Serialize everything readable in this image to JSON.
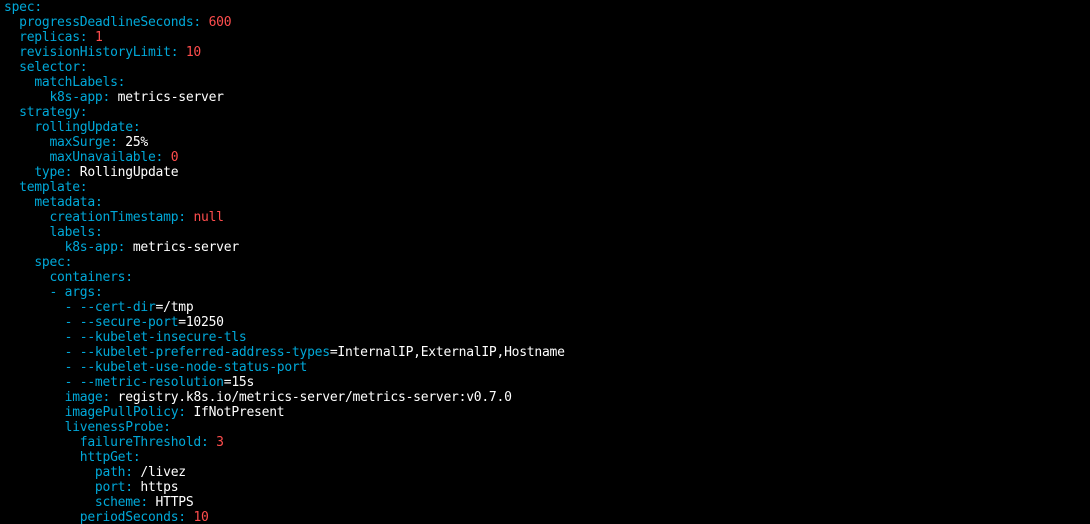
{
  "colors": {
    "background": "#000000",
    "key": "#00a8d8",
    "string_value": "#ffffff",
    "number_value": "#ff4d4d"
  },
  "lines": [
    {
      "indent": "",
      "key": "spec",
      "sep": ":",
      "value": "",
      "vtype": "v"
    },
    {
      "indent": "  ",
      "key": "progressDeadlineSeconds",
      "sep": ": ",
      "value": "600",
      "vtype": "n"
    },
    {
      "indent": "  ",
      "key": "replicas",
      "sep": ": ",
      "value": "1",
      "vtype": "n"
    },
    {
      "indent": "  ",
      "key": "revisionHistoryLimit",
      "sep": ": ",
      "value": "10",
      "vtype": "n"
    },
    {
      "indent": "  ",
      "key": "selector",
      "sep": ":",
      "value": "",
      "vtype": "v"
    },
    {
      "indent": "    ",
      "key": "matchLabels",
      "sep": ":",
      "value": "",
      "vtype": "v"
    },
    {
      "indent": "      ",
      "key": "k8s-app",
      "sep": ": ",
      "value": "metrics-server",
      "vtype": "v"
    },
    {
      "indent": "  ",
      "key": "strategy",
      "sep": ":",
      "value": "",
      "vtype": "v"
    },
    {
      "indent": "    ",
      "key": "rollingUpdate",
      "sep": ":",
      "value": "",
      "vtype": "v"
    },
    {
      "indent": "      ",
      "key": "maxSurge",
      "sep": ": ",
      "value": "25%",
      "vtype": "v"
    },
    {
      "indent": "      ",
      "key": "maxUnavailable",
      "sep": ": ",
      "value": "0",
      "vtype": "n"
    },
    {
      "indent": "    ",
      "key": "type",
      "sep": ": ",
      "value": "RollingUpdate",
      "vtype": "v"
    },
    {
      "indent": "  ",
      "key": "template",
      "sep": ":",
      "value": "",
      "vtype": "v"
    },
    {
      "indent": "    ",
      "key": "metadata",
      "sep": ":",
      "value": "",
      "vtype": "v"
    },
    {
      "indent": "      ",
      "key": "creationTimestamp",
      "sep": ": ",
      "value": "null",
      "vtype": "n"
    },
    {
      "indent": "      ",
      "key": "labels",
      "sep": ":",
      "value": "",
      "vtype": "v"
    },
    {
      "indent": "        ",
      "key": "k8s-app",
      "sep": ": ",
      "value": "metrics-server",
      "vtype": "v"
    },
    {
      "indent": "    ",
      "key": "spec",
      "sep": ":",
      "value": "",
      "vtype": "v"
    },
    {
      "indent": "      ",
      "key": "containers",
      "sep": ":",
      "value": "",
      "vtype": "v"
    },
    {
      "indent": "      ",
      "key": "- args",
      "sep": ":",
      "value": "",
      "vtype": "v"
    },
    {
      "indent": "        ",
      "key": "- --cert-dir",
      "sep": "",
      "value": "=/tmp",
      "vtype": "v"
    },
    {
      "indent": "        ",
      "key": "- --secure-port",
      "sep": "",
      "value": "=10250",
      "vtype": "v"
    },
    {
      "indent": "        ",
      "key": "- --kubelet-insecure-tls",
      "sep": "",
      "value": "",
      "vtype": "v"
    },
    {
      "indent": "        ",
      "key": "- --kubelet-preferred-address-types",
      "sep": "",
      "value": "=InternalIP,ExternalIP,Hostname",
      "vtype": "v"
    },
    {
      "indent": "        ",
      "key": "- --kubelet-use-node-status-port",
      "sep": "",
      "value": "",
      "vtype": "v"
    },
    {
      "indent": "        ",
      "key": "- --metric-resolution",
      "sep": "",
      "value": "=15s",
      "vtype": "v"
    },
    {
      "indent": "        ",
      "key": "image",
      "sep": ": ",
      "value": "registry.k8s.io/metrics-server/metrics-server:v0.7.0",
      "vtype": "v"
    },
    {
      "indent": "        ",
      "key": "imagePullPolicy",
      "sep": ": ",
      "value": "IfNotPresent",
      "vtype": "v"
    },
    {
      "indent": "        ",
      "key": "livenessProbe",
      "sep": ":",
      "value": "",
      "vtype": "v"
    },
    {
      "indent": "          ",
      "key": "failureThreshold",
      "sep": ": ",
      "value": "3",
      "vtype": "n"
    },
    {
      "indent": "          ",
      "key": "httpGet",
      "sep": ":",
      "value": "",
      "vtype": "v"
    },
    {
      "indent": "            ",
      "key": "path",
      "sep": ": ",
      "value": "/livez",
      "vtype": "v"
    },
    {
      "indent": "            ",
      "key": "port",
      "sep": ": ",
      "value": "https",
      "vtype": "v"
    },
    {
      "indent": "            ",
      "key": "scheme",
      "sep": ": ",
      "value": "HTTPS",
      "vtype": "v"
    },
    {
      "indent": "          ",
      "key": "periodSeconds",
      "sep": ": ",
      "value": "10",
      "vtype": "n"
    }
  ]
}
